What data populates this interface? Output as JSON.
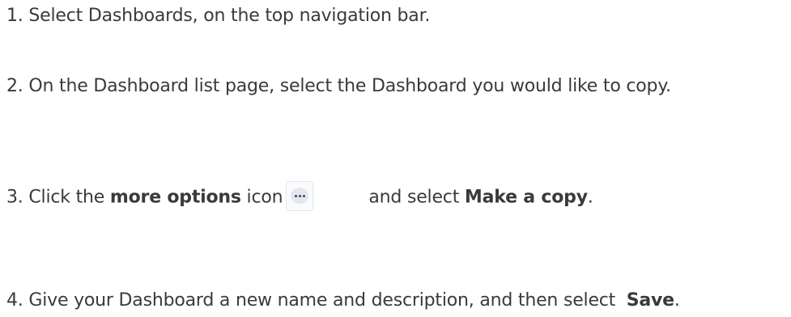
{
  "steps": [
    {
      "text": "1. Select Dashboards, on the top navigation bar."
    },
    {
      "text": "2. On the Dashboard list page, select the Dashboard you would like to copy."
    },
    {
      "prefix": "3. Click the ",
      "bold1": "more options",
      "mid": " icon",
      "after_icon": "and select ",
      "bold2": "Make a copy",
      "end": ".",
      "icon": "more-options-icon"
    },
    {
      "prefix": "4. Give your Dashboard a new name and description, and then select  ",
      "bold": "Save",
      "end": "."
    }
  ]
}
